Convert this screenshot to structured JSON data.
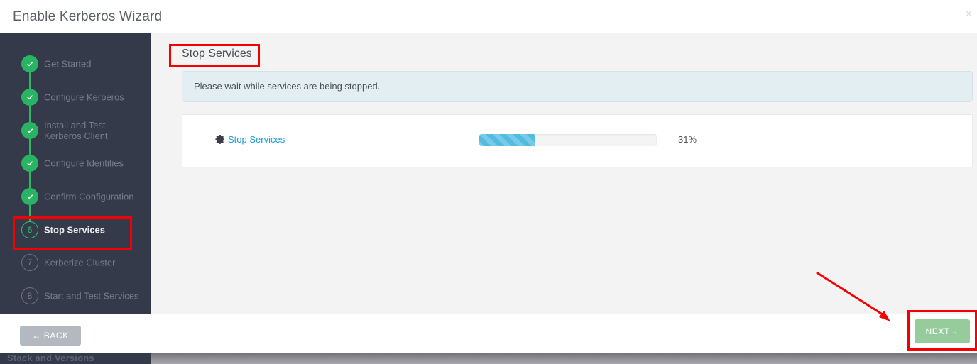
{
  "header": {
    "title": "Enable Kerberos Wizard",
    "close_icon": "close-icon",
    "close_label": "×"
  },
  "background": {
    "strip_label": "Stack and Versions"
  },
  "sidebar": {
    "steps": [
      {
        "number": "1",
        "label": "Get Started",
        "state": "done",
        "icon": "check-icon"
      },
      {
        "number": "2",
        "label": "Configure Kerberos",
        "state": "done",
        "icon": "check-icon"
      },
      {
        "number": "3",
        "label": "Install and Test\nKerberos Client",
        "state": "done",
        "icon": "check-icon"
      },
      {
        "number": "4",
        "label": "Configure Identities",
        "state": "done",
        "icon": "check-icon"
      },
      {
        "number": "5",
        "label": "Confirm Configuration",
        "state": "done",
        "icon": "check-icon"
      },
      {
        "number": "6",
        "label": "Stop Services",
        "state": "active",
        "icon": "step-number"
      },
      {
        "number": "7",
        "label": "Kerberize Cluster",
        "state": "todo",
        "icon": "step-number"
      },
      {
        "number": "8",
        "label": "Start and Test Services",
        "state": "todo",
        "icon": "step-number"
      }
    ]
  },
  "main": {
    "title": "Stop Services",
    "alert_text": "Please wait while services are being stopped.",
    "task": {
      "icon": "gear-icon",
      "link_label": "Stop Services",
      "progress_percent": 31,
      "progress_label": "31%"
    }
  },
  "footer": {
    "back_label": "← BACK",
    "next_label": "NEXT→"
  },
  "colors": {
    "sidebar_bg": "#353a4a",
    "step_done": "#28b463",
    "step_active": "#2fc46b",
    "accent_link": "#1a9bd7",
    "progress_fill": "#52bbe0",
    "next_button": "#96cb9b",
    "back_button": "#b4b8c1",
    "alert_bg": "#e3eef3",
    "annotation": "#f50000"
  }
}
